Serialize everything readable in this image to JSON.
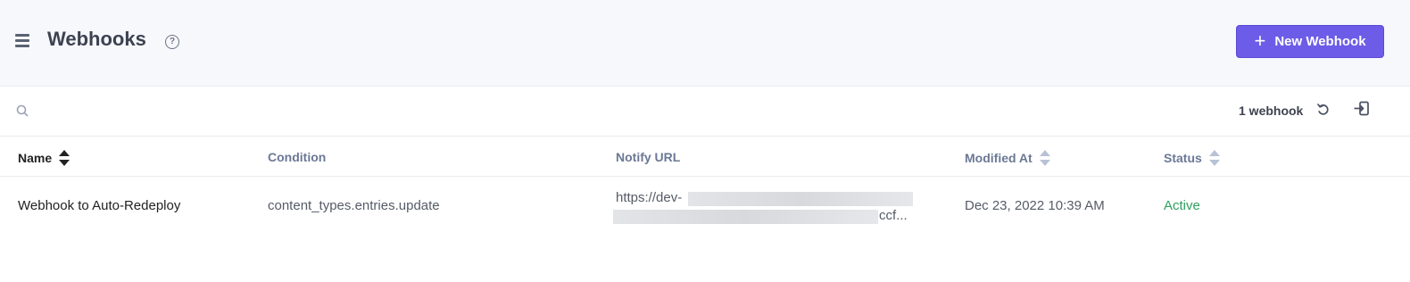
{
  "header": {
    "title": "Webhooks",
    "help_icon": "question-circle-icon",
    "menu_icon": "hamburger-icon",
    "new_button_label": "New Webhook",
    "accent_color": "#6c5ce7"
  },
  "toolbar": {
    "search_placeholder": "",
    "count_text": "1 webhook",
    "refresh_icon": "refresh-icon",
    "export_icon": "export-icon"
  },
  "table": {
    "columns": [
      "Name",
      "Condition",
      "Notify URL",
      "Modified At",
      "Status"
    ],
    "rows": [
      {
        "name": "Webhook to Auto-Redeploy",
        "condition": "content_types.entries.update",
        "notify_url_visible_start": "https://dev-",
        "notify_url_visible_end": "ccf...",
        "modified_at": "Dec 23, 2022 10:39 AM",
        "status": "Active"
      }
    ]
  },
  "colors": {
    "status_active": "#2e9f5f",
    "header_bg": "#f7f8fc"
  }
}
